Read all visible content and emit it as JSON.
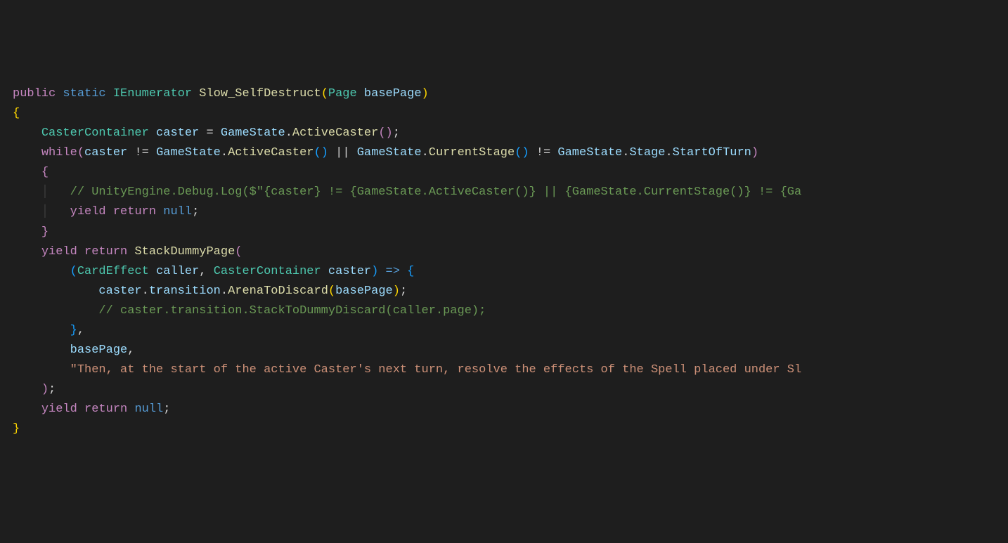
{
  "colors": {
    "background": "#1e1e1e",
    "keyword_flow": "#c586c0",
    "keyword_type": "#569cd6",
    "type": "#4ec9b0",
    "method": "#dcdcaa",
    "identifier": "#9cdcfe",
    "comment": "#6a9955",
    "string": "#ce9178"
  },
  "code": {
    "l1": {
      "public": "public",
      "static": "static",
      "ret_type": "IEnumerator",
      "name": "Slow_SelfDestruct",
      "param_type": "Page",
      "param_name": "basePage"
    },
    "l2": {
      "brace": "{"
    },
    "l3": {
      "type": "CasterContainer",
      "var": "caster",
      "eq": " = ",
      "obj": "GameState",
      "dot": ".",
      "call": "ActiveCaster",
      "end": "();"
    },
    "l4": {
      "while": "while",
      "open": "(",
      "var": "caster",
      "neq": " != ",
      "gs": "GameState",
      "dot": ".",
      "ac": "ActiveCaster",
      "parens": "()",
      "or": " || ",
      "cs": "CurrentStage",
      "neq2": " != ",
      "stage": "Stage",
      "sot": "StartOfTurn",
      "close": ")"
    },
    "l5": {
      "brace": "{"
    },
    "l6": {
      "comment": "// UnityEngine.Debug.Log($\"{caster} != {GameState.ActiveCaster()} || {GameState.CurrentStage()} != {Ga"
    },
    "l7": {
      "yield": "yield",
      "return": "return",
      "null": "null",
      "semi": ";"
    },
    "l8": {
      "brace": "}"
    },
    "l9": {
      "yield": "yield",
      "return": "return",
      "call": "StackDummyPage",
      "open": "("
    },
    "l10": {
      "open": "(",
      "t1": "CardEffect",
      "p1": "caller",
      "comma": ", ",
      "t2": "CasterContainer",
      "p2": "caster",
      "close": ")",
      "arrow": " => ",
      "brace": "{"
    },
    "l11": {
      "obj": "caster",
      "dot1": ".",
      "prop": "transition",
      "dot2": ".",
      "call": "ArenaToDiscard",
      "open": "(",
      "arg": "basePage",
      "close": ");"
    },
    "l12": {
      "comment": "// caster.transition.StackToDummyDiscard(caller.page);"
    },
    "l13": {
      "brace": "}",
      "comma": ","
    },
    "l14": {
      "arg": "basePage",
      "comma": ","
    },
    "l15": {
      "string": "\"Then, at the start of the active Caster's next turn, resolve the effects of the Spell placed under Sl"
    },
    "l16": {
      "close": ")",
      "semi": ";"
    },
    "l17": {
      "yield": "yield",
      "return": "return",
      "null": "null",
      "semi": ";"
    },
    "l18": {
      "brace": "}"
    }
  }
}
